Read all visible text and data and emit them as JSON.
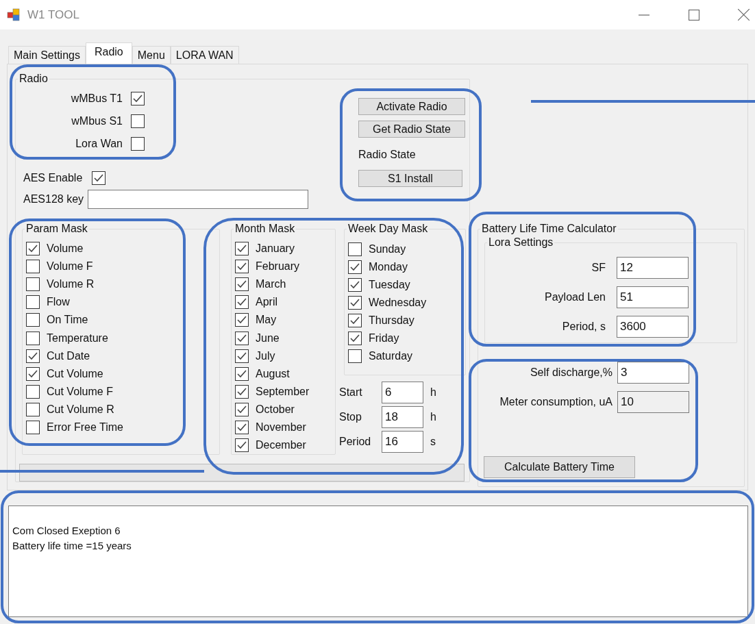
{
  "window": {
    "title": "W1 TOOL"
  },
  "tabs": [
    {
      "label": "Main Settings",
      "selected": false
    },
    {
      "label": "Radio",
      "selected": true
    },
    {
      "label": "Menu",
      "selected": false
    },
    {
      "label": "LORA WAN",
      "selected": false
    }
  ],
  "radio_group": {
    "title": "Radio",
    "options": [
      {
        "label": "wMBus T1",
        "checked": true
      },
      {
        "label": "wMbus S1",
        "checked": false
      },
      {
        "label": "Lora Wan",
        "checked": false
      }
    ]
  },
  "aes": {
    "enable_label": "AES Enable",
    "enabled": true,
    "key_label": "AES128 key"
  },
  "radio_buttons": [
    "Activate Radio",
    "Get Radio State"
  ],
  "radio_state_label": "Radio State",
  "install_button": "S1 Install",
  "param_mask": {
    "title": "Param Mask",
    "items": [
      {
        "label": "Volume",
        "checked": true
      },
      {
        "label": "Volume F",
        "checked": false
      },
      {
        "label": "Volume R",
        "checked": false
      },
      {
        "label": "Flow",
        "checked": false
      },
      {
        "label": "On Time",
        "checked": false
      },
      {
        "label": "Temperature",
        "checked": false
      },
      {
        "label": "Cut Date",
        "checked": true
      },
      {
        "label": "Cut Volume",
        "checked": true
      },
      {
        "label": "Cut Volume F",
        "checked": false
      },
      {
        "label": "Cut Volume R",
        "checked": false
      },
      {
        "label": "Error Free Time",
        "checked": false
      }
    ]
  },
  "month_mask": {
    "title": "Month Mask",
    "items": [
      {
        "label": "January",
        "checked": true
      },
      {
        "label": "February",
        "checked": true
      },
      {
        "label": "March",
        "checked": true
      },
      {
        "label": "April",
        "checked": true
      },
      {
        "label": "May",
        "checked": true
      },
      {
        "label": "June",
        "checked": true
      },
      {
        "label": "July",
        "checked": true
      },
      {
        "label": "August",
        "checked": true
      },
      {
        "label": "September",
        "checked": true
      },
      {
        "label": "October",
        "checked": true
      },
      {
        "label": "November",
        "checked": true
      },
      {
        "label": "December",
        "checked": true
      }
    ]
  },
  "week_day_mask": {
    "title": "Week Day Mask",
    "items": [
      {
        "label": "Sunday",
        "checked": false
      },
      {
        "label": "Monday",
        "checked": true
      },
      {
        "label": "Tuesday",
        "checked": true
      },
      {
        "label": "Wednesday",
        "checked": true
      },
      {
        "label": "Thursday",
        "checked": true
      },
      {
        "label": "Friday",
        "checked": true
      },
      {
        "label": "Saturday",
        "checked": false
      }
    ]
  },
  "schedule": [
    {
      "label": "Start",
      "value": "6",
      "unit": "h"
    },
    {
      "label": "Stop",
      "value": "18",
      "unit": "h"
    },
    {
      "label": "Period",
      "value": "16",
      "unit": "s"
    }
  ],
  "battery_calculator": {
    "title": "Battery Life Time Calculator",
    "lora_settings": {
      "title": "Lora Settings",
      "fields": [
        {
          "label": "SF",
          "value": "12"
        },
        {
          "label": "Payload Len",
          "value": "51"
        },
        {
          "label": "Period, s",
          "value": "3600"
        }
      ]
    },
    "fields": [
      {
        "label": "Self discharge,%",
        "value": "3",
        "disabled": false
      },
      {
        "label": "Meter consumption, uA",
        "value": "10",
        "disabled": true
      }
    ],
    "button": "Calculate Battery Time"
  },
  "progress_bar": {
    "level": 0
  },
  "log": {
    "lines": [
      "Com Closed Exeption 6",
      "Battery life time =15 years"
    ]
  }
}
